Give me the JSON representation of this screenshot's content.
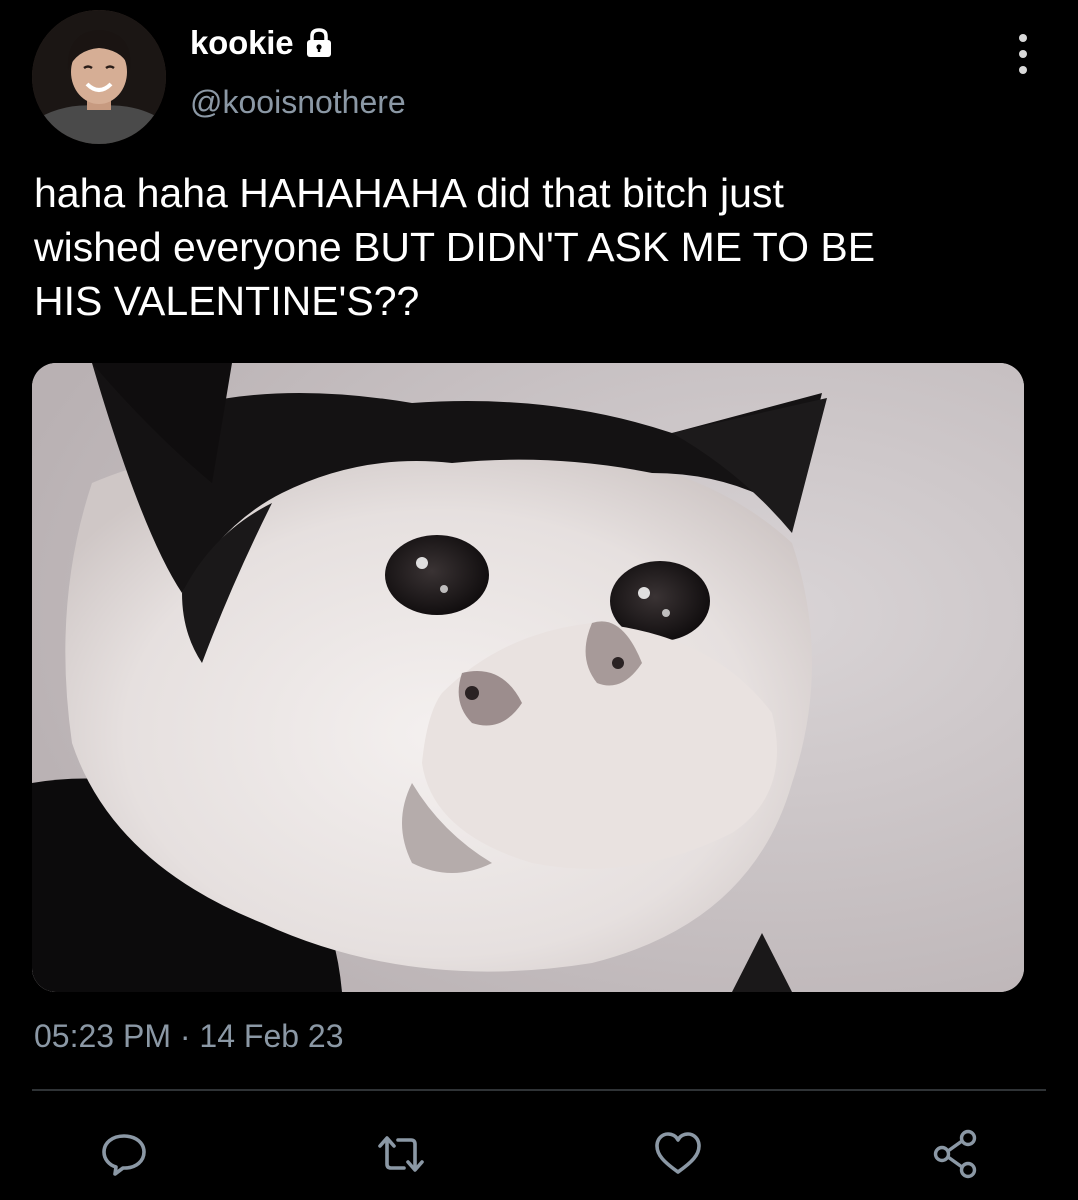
{
  "user": {
    "display_name": "kookie",
    "handle": "@kooisnothere",
    "protected": true
  },
  "tweet": {
    "text": "haha haha HAHAHAHA did that bitch just\nwished everyone BUT DIDN'T ASK ME TO BE\nHIS VALENTINE'S??",
    "time": "05:23 PM",
    "separator": "·",
    "date": "14 Feb 23"
  },
  "actions": {
    "reply_icon": "reply-icon",
    "retweet_icon": "retweet-icon",
    "like_icon": "heart-icon",
    "share_icon": "share-icon"
  },
  "theme": {
    "background": "#000000",
    "text": "#ffffff",
    "secondary_text": "#8b98a5",
    "icon": "#8b98a5",
    "divider": "#2f3336"
  }
}
